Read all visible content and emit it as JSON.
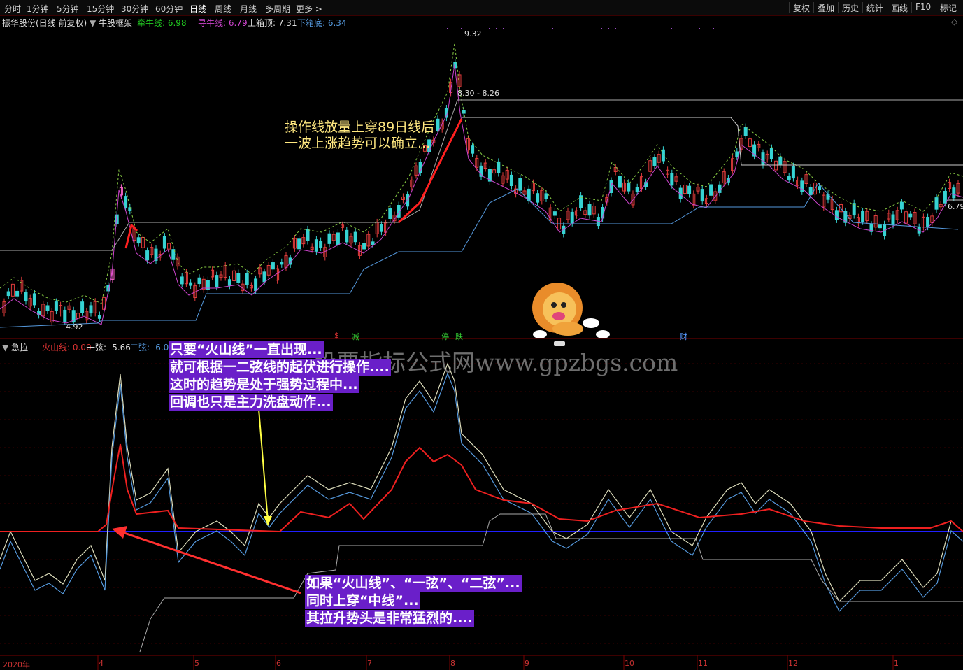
{
  "toolbar": {
    "periods": [
      "分时",
      "1分钟",
      "5分钟",
      "15分钟",
      "30分钟",
      "60分钟",
      "日线",
      "周线",
      "月线",
      "多周期",
      "更多 >"
    ],
    "active_period": "日线",
    "right_buttons": [
      "复权",
      "叠加",
      "历史",
      "统计",
      "画线",
      "F10",
      "标记"
    ]
  },
  "main_panel": {
    "stock_name": "振华股份(日线 前复权)",
    "indicator": "牛股框架",
    "legend": [
      {
        "label": "牵牛线: 6.98",
        "color": "#22cc22"
      },
      {
        "label": "寻牛线: 6.79",
        "color": "#cc44cc"
      },
      {
        "label": "上箱顶: 7.31",
        "color": "#dddddd"
      },
      {
        "label": "下箱底: 6.34",
        "color": "#5599dd"
      }
    ],
    "price_high": "9.32",
    "price_low": "4.92",
    "range_label": "8.30 - 8.26",
    "right_price": "6.79",
    "annotation": [
      "操作线放量上穿89日线后",
      "一波上涨趋势可以确立..."
    ],
    "markers": [
      {
        "text": "$",
        "color": "#dd3333"
      },
      {
        "text": "减",
        "color": "#33cc33"
      },
      {
        "text": "停",
        "color": "#33cc33"
      },
      {
        "text": "跌",
        "color": "#33cc33"
      },
      {
        "text": "财",
        "color": "#5599ff"
      }
    ]
  },
  "sub_panel": {
    "name": "急拉",
    "legend": [
      {
        "label": "火山线: 0.00",
        "color": "#dd3333"
      },
      {
        "label": "一弦: -5.66",
        "color": "#dddddd"
      },
      {
        "label": "二弦: -6.00",
        "color": "#5599dd"
      }
    ],
    "annotation_top": [
      "只要“火山线”一直出现...",
      "就可根据一二弦线的起伏进行操作....",
      "这时的趋势是处于强势过程中...",
      "回调也只是主力洗盘动作..."
    ],
    "annotation_bottom": [
      "如果“火山线”、“一弦”、“二弦”...",
      "同时上穿“中线”...",
      "其拉升势头是非常猛烈的...."
    ]
  },
  "watermark": "股票指标公式网www.gpzbgs.com",
  "date_axis": [
    "2020年",
    "4",
    "5",
    "6",
    "7",
    "8",
    "9",
    "10",
    "11",
    "12",
    "1"
  ]
}
